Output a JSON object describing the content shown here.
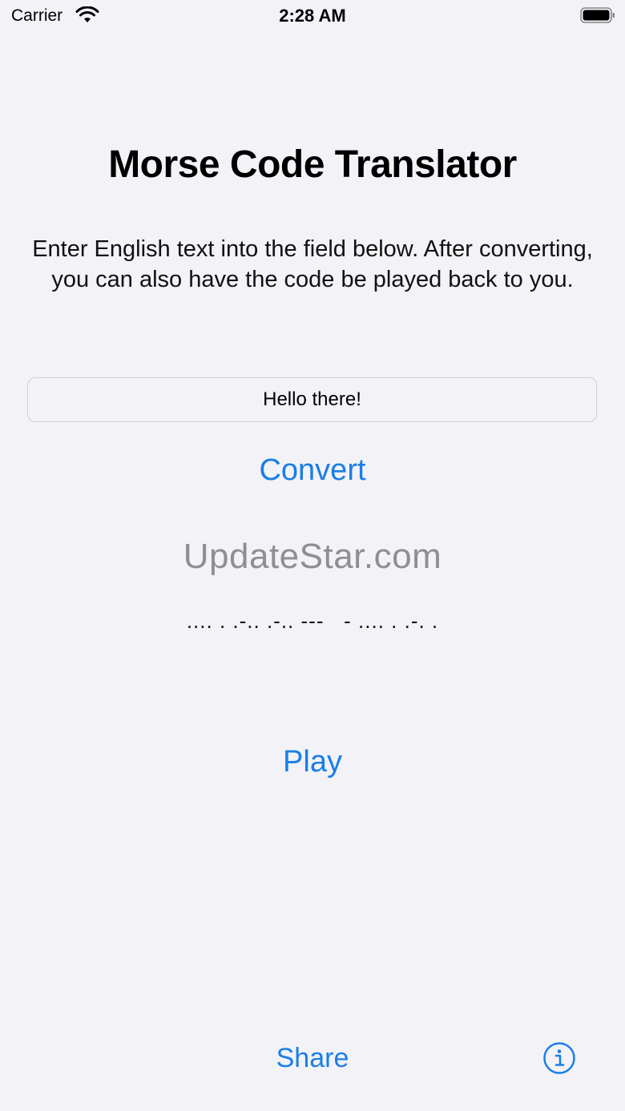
{
  "status_bar": {
    "carrier": "Carrier",
    "time": "2:28 AM"
  },
  "main": {
    "title": "Morse Code Translator",
    "instructions": "Enter English text into the field below. After converting, you can also have the code be played back to you.",
    "input_value": "Hello there!",
    "convert_label": "Convert",
    "watermark": "UpdateStar.com",
    "morse_output": ".... . .-.. .-.. ---   - .... . .-. .",
    "play_label": "Play"
  },
  "footer": {
    "share_label": "Share",
    "info_icon": "info-circle-icon"
  },
  "colors": {
    "accent": "#1a7ee6",
    "background": "#f2f2f7"
  }
}
